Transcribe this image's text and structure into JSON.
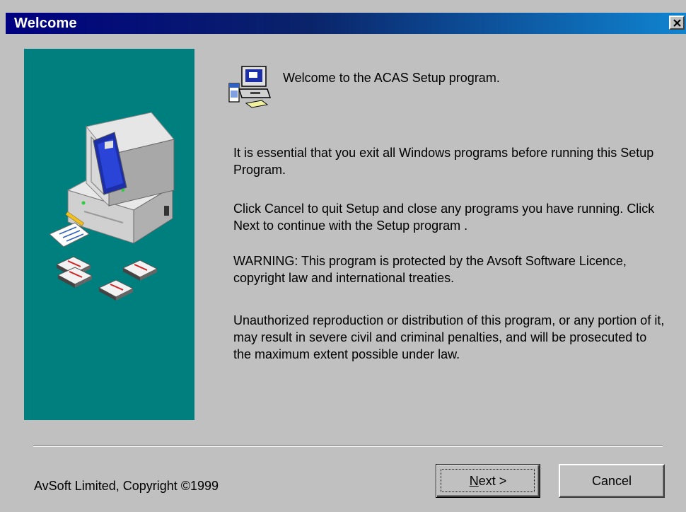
{
  "window": {
    "title": "Welcome"
  },
  "main": {
    "welcome_line": "Welcome to the ACAS Setup program.",
    "paragraphs": [
      "It is essential that you exit all Windows programs before running this Setup Program.",
      "Click Cancel to quit Setup and close any programs you have running.  Click Next to continue with the Setup program .",
      "WARNING: This program is protected by the Avsoft Software Licence, copyright law and international treaties.",
      "Unauthorized reproduction or distribution of this program, or any portion of it, may result in severe civil and criminal penalties, and will be prosecuted to the maximum extent possible under law."
    ]
  },
  "footer": {
    "copyright": "AvSoft Limited, Copyright ©1999",
    "next_accel": "N",
    "next_rest": "ext >",
    "cancel_label": "Cancel"
  },
  "icons": {
    "close": "close-icon",
    "setup": "setup-computer-icon",
    "illustration": "computer-with-disks-illustration"
  },
  "colors": {
    "titlebar_start": "#000080",
    "titlebar_end": "#1084d0",
    "side_panel": "#007f7f",
    "dialog_bg": "#c0c0c0"
  }
}
